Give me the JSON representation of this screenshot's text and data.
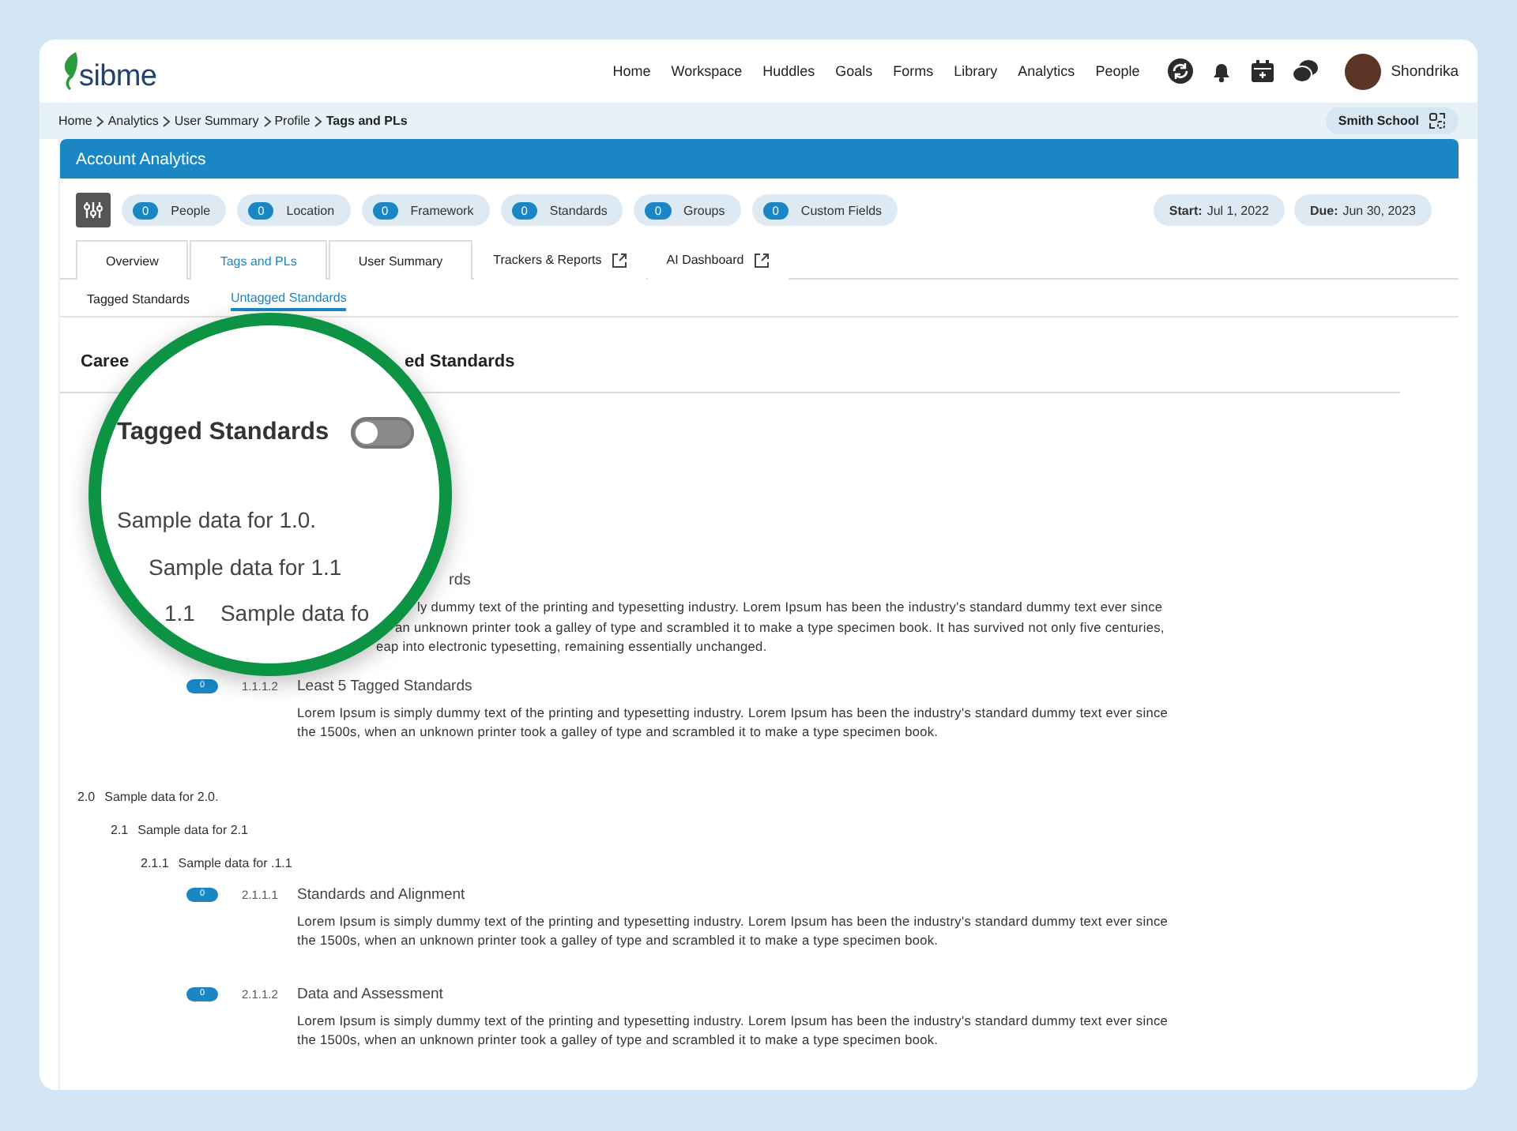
{
  "header": {
    "logo": "sibme",
    "nav": [
      "Home",
      "Workspace",
      "Huddles",
      "Goals",
      "Forms",
      "Library",
      "Analytics",
      "People"
    ],
    "user": "Shondrika"
  },
  "breadcrumb": [
    "Home",
    "Analytics",
    "User Summary",
    "Profile",
    "Tags and PLs"
  ],
  "school": "Smith School",
  "banner": {
    "title": "Account Analytics"
  },
  "filters": [
    {
      "count": "0",
      "label": "People"
    },
    {
      "count": "0",
      "label": "Location"
    },
    {
      "count": "0",
      "label": "Framework"
    },
    {
      "count": "0",
      "label": "Standards"
    },
    {
      "count": "0",
      "label": "Groups"
    },
    {
      "count": "0",
      "label": "Custom Fields"
    }
  ],
  "dates": [
    {
      "label": "Start:",
      "value": "Jul 1, 2022"
    },
    {
      "label": "Due:",
      "value": "Jun 30, 2023"
    }
  ],
  "tabs": [
    {
      "label": "Overview",
      "selected": false,
      "kind": "tab"
    },
    {
      "label": "Tags and PLs",
      "selected": true,
      "kind": "tab"
    },
    {
      "label": "User Summary",
      "selected": false,
      "kind": "tab"
    },
    {
      "label": "Trackers & Reports",
      "selected": false,
      "kind": "external"
    },
    {
      "label": "AI Dashboard",
      "selected": false,
      "kind": "external"
    }
  ],
  "subtabs": [
    {
      "label": "Tagged Standards",
      "selected": false
    },
    {
      "label": "Untagged Standards",
      "selected": true
    }
  ],
  "heading_fragments": [
    "Caree",
    "ed Standards"
  ],
  "partial_standard": {
    "title": "rds",
    "lines": [
      "ly dummy text of the printing and typesetting industry. Lorem Ipsum has been the industry's standard dummy text ever since",
      "an unknown printer took a galley of type and scrambled it to make a type specimen book. It has survived not only five centuries,",
      "eap into electronic typesetting, remaining essentially unchanged."
    ]
  },
  "standards_1": [
    {
      "count": "0",
      "number": "1.1.1.2",
      "title": "Least 5 Tagged Standards",
      "body": "Lorem Ipsum is simply dummy text of the printing and typesetting industry. Lorem Ipsum has been the industry's standard dummy text ever since the 1500s, when an unknown printer took a galley of type and scrambled it to make a type specimen book."
    }
  ],
  "outline": [
    {
      "number": "2.0",
      "text": "Sample data for 2.0.",
      "children": [
        {
          "number": "2.1",
          "text": "Sample data for 2.1",
          "children": [
            {
              "number": "2.1.1",
              "text": "Sample data for .1.1",
              "standards": [
                {
                  "count": "0",
                  "number": "2.1.1.1",
                  "title": "Standards and Alignment",
                  "body": "Lorem Ipsum is simply dummy text of the printing and typesetting industry. Lorem Ipsum has been the industry's standard dummy text ever since the 1500s, when an unknown printer took a galley of type and scrambled it to make a type specimen book."
                },
                {
                  "count": "0",
                  "number": "2.1.1.2",
                  "title": "Data and Assessment",
                  "body": "Lorem Ipsum is simply dummy text of the printing and typesetting industry. Lorem Ipsum has been the industry's standard dummy text ever since the 1500s, when an unknown printer took a galley of type and scrambled it to make a type specimen book."
                }
              ]
            }
          ]
        }
      ]
    }
  ],
  "magnifier": {
    "toggle": {
      "label": "Tagged Standards",
      "on": false
    },
    "lines": [
      "Sample data for 1.0.",
      "Sample data for 1.1"
    ],
    "last": {
      "number": "1.1",
      "text": "Sample data fo"
    }
  }
}
